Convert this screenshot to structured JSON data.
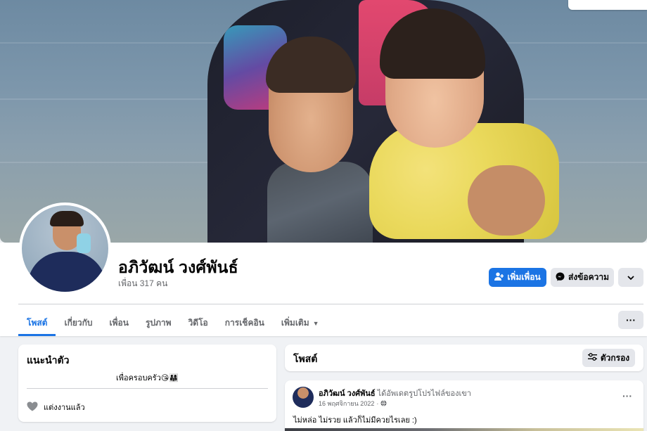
{
  "profile": {
    "name": "อภิวัฒน์ วงศ์พันธ์",
    "friends_count": "เพื่อน 317 คน"
  },
  "actions": {
    "add_friend": "เพิ่มเพื่อน",
    "message": "ส่งข้อความ"
  },
  "tabs": [
    {
      "label": "โพสต์",
      "active": true
    },
    {
      "label": "เกี่ยวกับ"
    },
    {
      "label": "เพื่อน"
    },
    {
      "label": "รูปภาพ"
    },
    {
      "label": "วิดีโอ"
    },
    {
      "label": "การเช็คอิน"
    },
    {
      "label": "เพิ่มเติม"
    }
  ],
  "intro": {
    "title": "แนะนำตัว",
    "bio": "เพื่อครอบครัว😘👨‍👩‍👧",
    "relationship": "แต่งงานแล้ว"
  },
  "posts": {
    "title": "โพสต์",
    "filter_label": "ตัวกรอง"
  },
  "post": {
    "author": "อภิวัฒน์ วงศ์พันธ์",
    "action": "ได้อัพเดตรูปโปรไฟล์ของเขา",
    "date": "16 พฤศจิกายน 2022",
    "text": "ไม่หล่อ ไม่รวย แล้วก็ไม่มีควยไรเลย :)"
  },
  "colors": {
    "accent": "#1b74e4",
    "background": "#f0f2f5",
    "button_gray": "#e4e6eb",
    "secondary_text": "#65676b"
  },
  "icons": [
    "add-friend-icon",
    "messenger-icon",
    "chevron-down-icon",
    "more-dots-icon",
    "heart-icon",
    "filter-icon",
    "globe-icon"
  ]
}
